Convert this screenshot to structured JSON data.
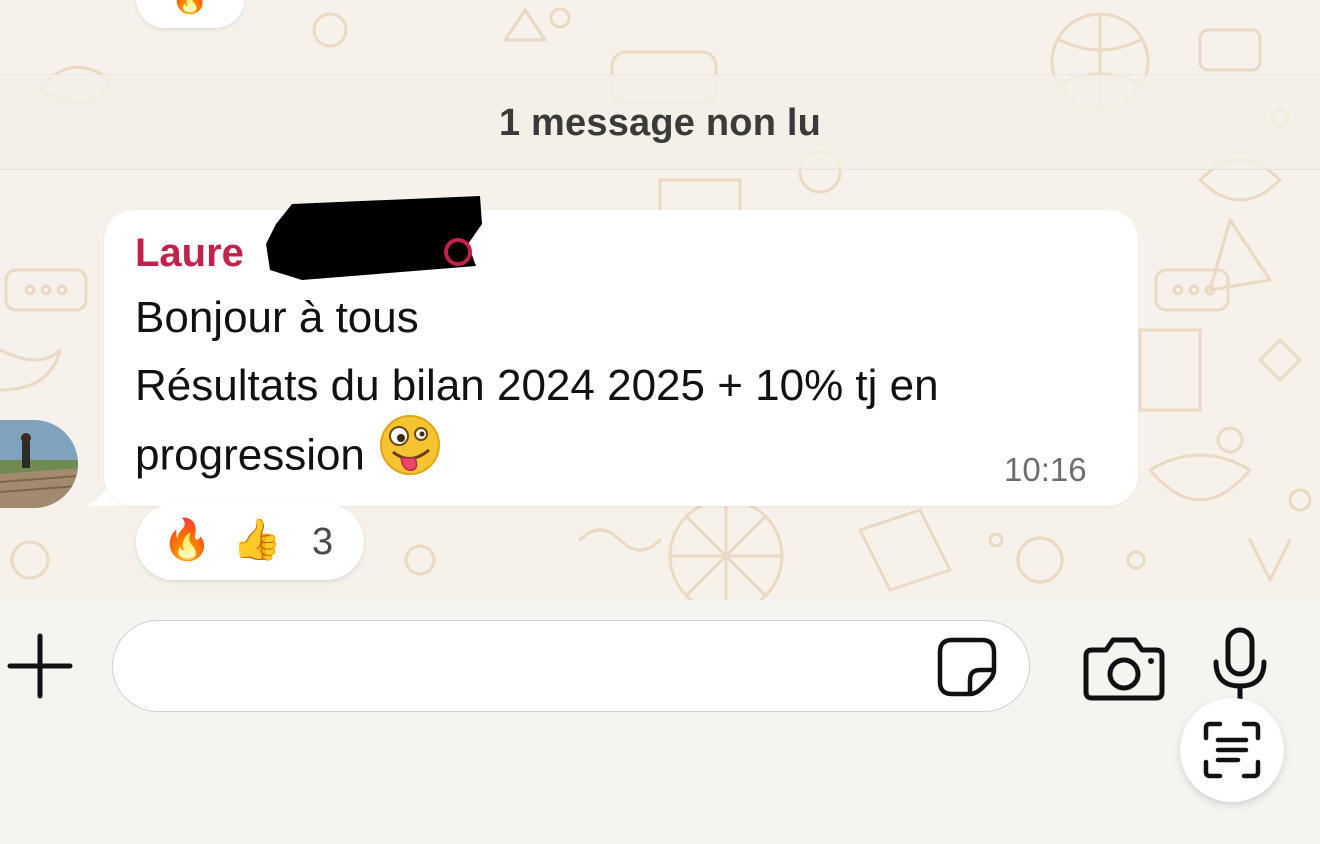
{
  "unread_banner": {
    "text": "1 message non lu"
  },
  "top_reaction": {
    "emoji": "🔥"
  },
  "message": {
    "sender": "Laure",
    "lines": [
      "Bonjour à tous",
      "Résultats du bilan 2024 2025 + 10% tj en",
      "progression"
    ],
    "emoji": "zany-face-icon",
    "time": "10:16"
  },
  "reactions": {
    "fire": "🔥",
    "thumbs_up": "👍",
    "count": "3"
  },
  "composer": {
    "input_value": "",
    "placeholder": ""
  },
  "colors": {
    "background": "#f6f1ea",
    "sender": "#c1214a",
    "bubble": "#ffffff",
    "pattern": "#ead9c3"
  }
}
